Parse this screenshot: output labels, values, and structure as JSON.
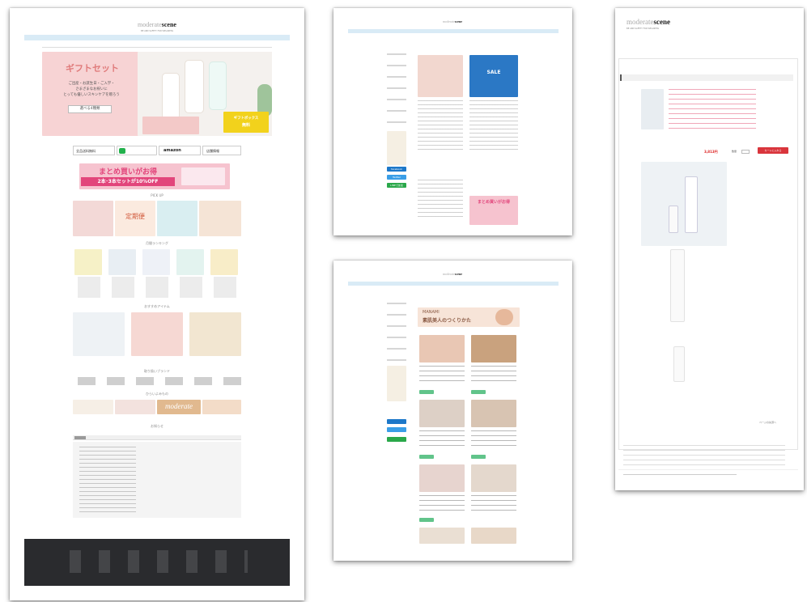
{
  "brand": {
    "logo_prefix": "moderate",
    "logo_main": "scene",
    "tagline": "BE AND SAFETY FOR WELLNESS"
  },
  "home": {
    "hero_title": "ギフトセット",
    "hero_line1": "ご出産・お誕生日・ご入学・",
    "hero_line2": "さまざまなお祝いに",
    "hero_line3": "とっても優しいスキンケアを贈ろう",
    "hero_button": "選べる4種類",
    "hero_badge_line1": "ギフトボックス",
    "hero_badge_line2": "無料",
    "badge_shipping": "全品送料無料",
    "badge_amazon": "amazon",
    "badge_store": "店舗情報",
    "bulk_line1": "まとめ買いがお得",
    "bulk_line2": "2本･3本セットが10%OFF",
    "pickup_title": "PICK UP",
    "pickup_teiki": "定期便",
    "ranking_title": "月間ランキング",
    "recommend_title": "おすすめアイテム",
    "brands_title": "取り扱いブランド",
    "reading_title": "ひらいよみもの",
    "news_title": "お知らせ",
    "reading_brand": "moderate"
  },
  "blog": {
    "banner_title": "まとめ買いがお得",
    "sale_label": "SALE",
    "social_facebook": "facebook",
    "social_twitter": "Twitter",
    "social_line": "LINEで友達"
  },
  "article": {
    "title_prefix": "MANAMI",
    "title_main": "素肌美人のつくりかた",
    "cta": "続きを読む"
  },
  "product": {
    "cart_button": "カートに入れる",
    "price": "3,813円",
    "quantity_label": "数量",
    "back_link": "ページの先頭へ"
  }
}
